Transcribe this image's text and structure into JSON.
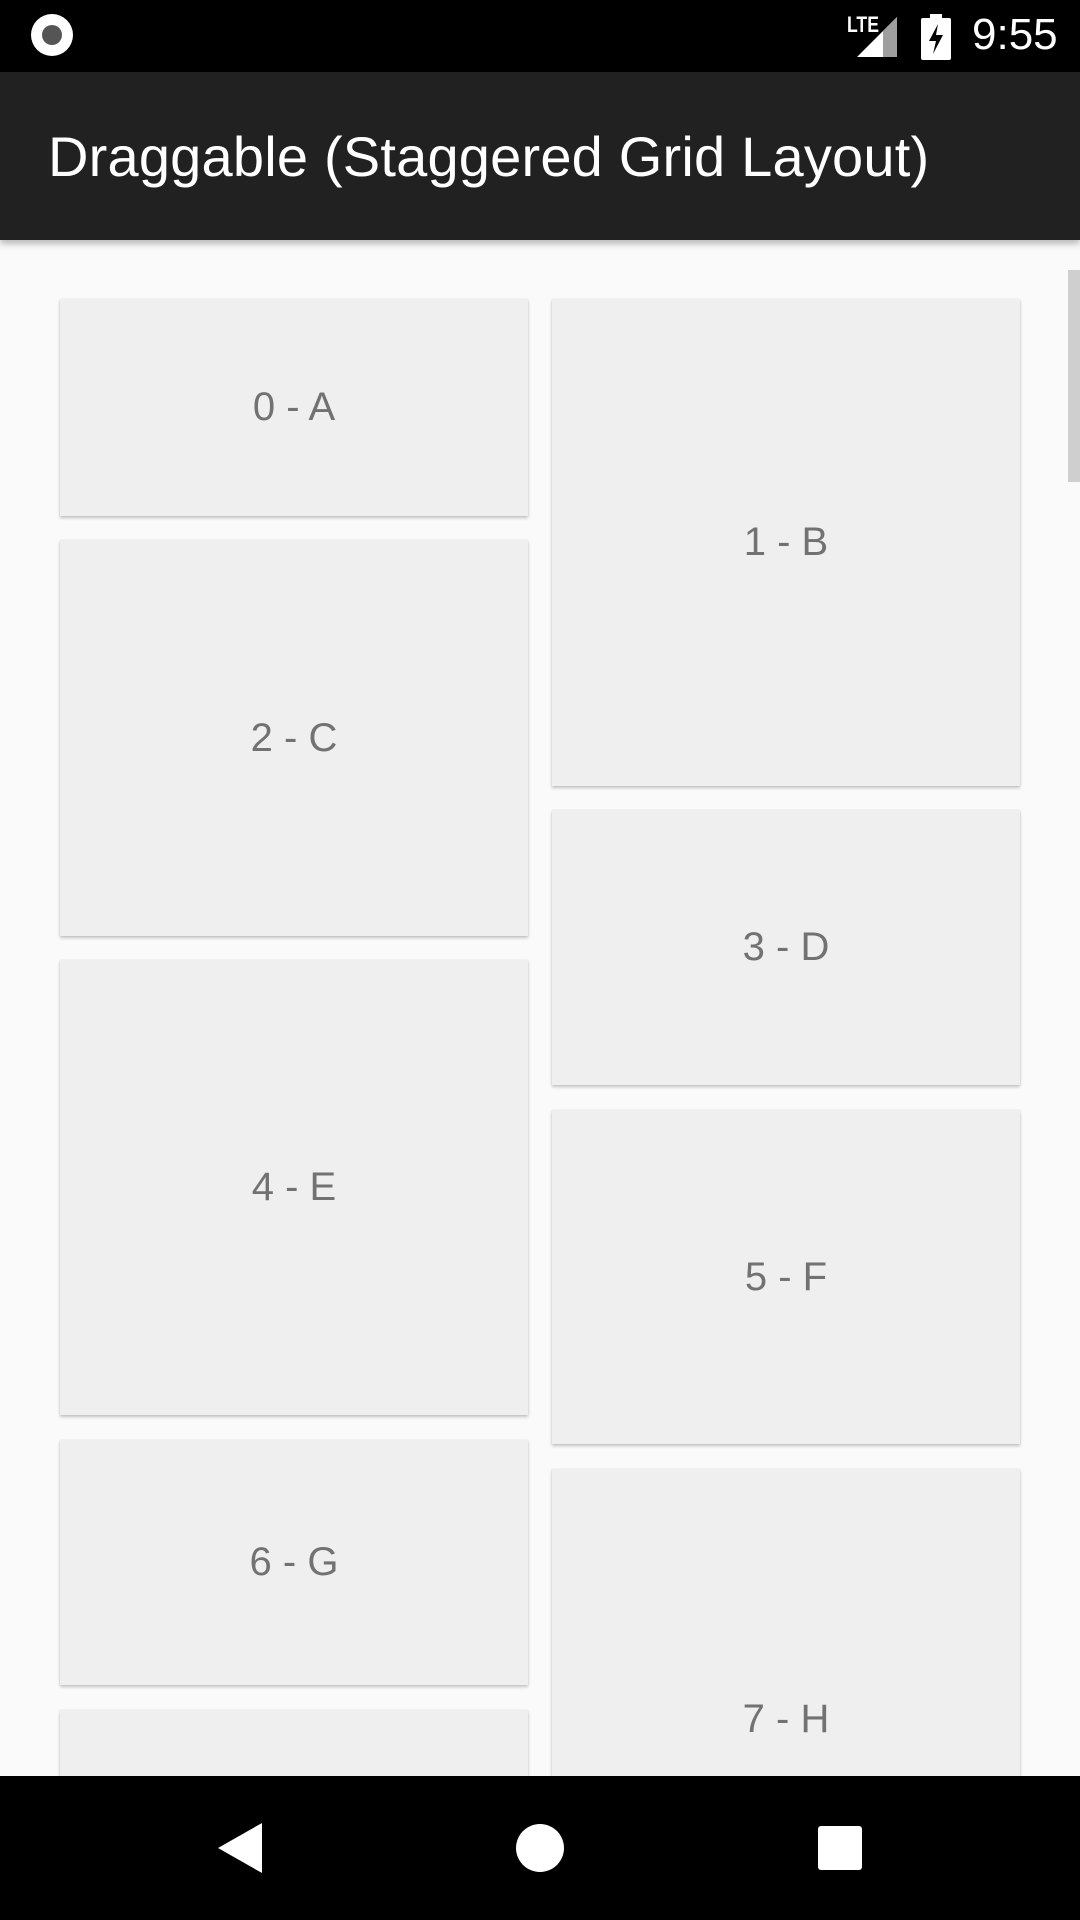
{
  "status_bar": {
    "time": "9:55",
    "network": "LTE",
    "icons": [
      "screen-record-icon",
      "signal-icon",
      "battery-charging-icon"
    ]
  },
  "app_bar": {
    "title": "Draggable (Staggered Grid Layout)"
  },
  "grid": {
    "items": [
      {
        "label": "0 - A"
      },
      {
        "label": "1 - B"
      },
      {
        "label": "2 - C"
      },
      {
        "label": "3 - D"
      },
      {
        "label": "4 - E"
      },
      {
        "label": "5 - F"
      },
      {
        "label": "6 - G"
      },
      {
        "label": "7 - H"
      },
      {
        "label": ""
      }
    ]
  },
  "nav_bar": {
    "buttons": [
      "back-icon",
      "home-icon",
      "recents-icon"
    ]
  },
  "colors": {
    "app_bar": "#212121",
    "background": "#fafafa",
    "card": "#efefef",
    "card_text": "#727272"
  }
}
